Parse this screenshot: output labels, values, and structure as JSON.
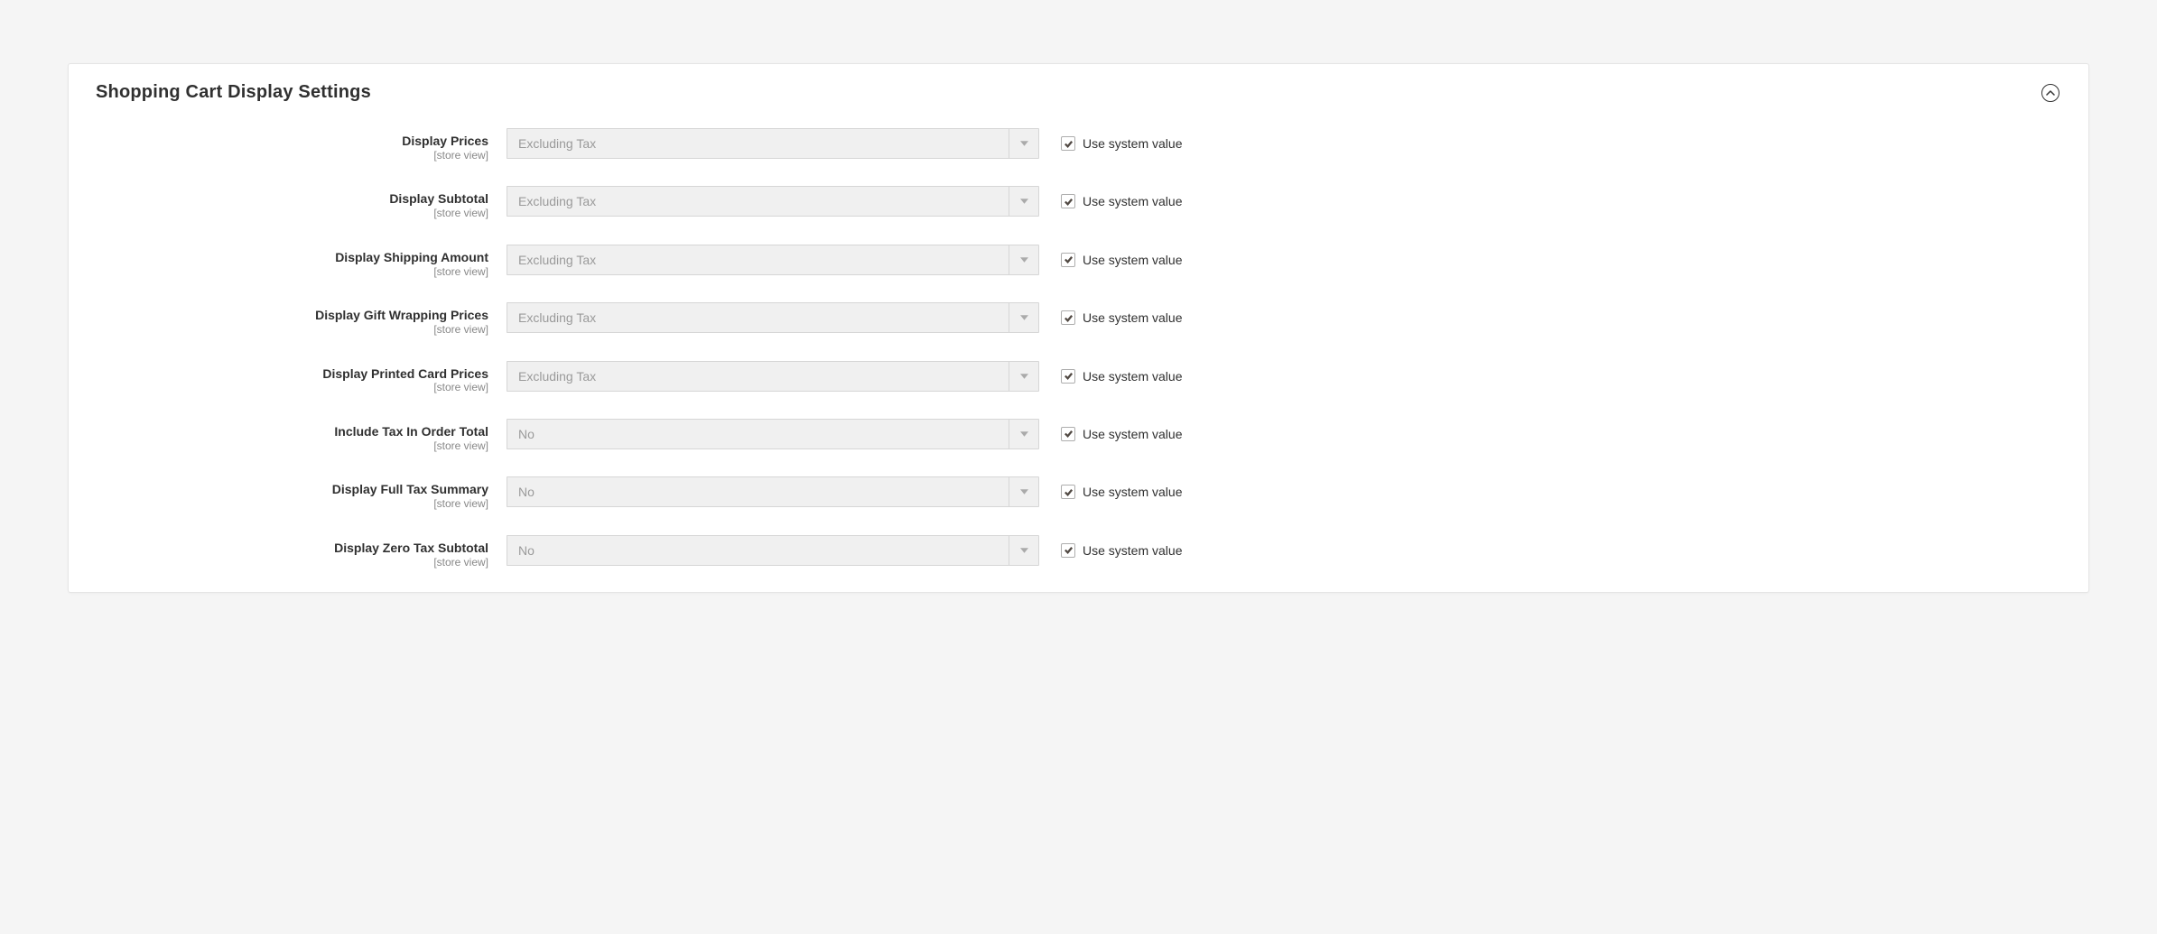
{
  "panel": {
    "title": "Shopping Cart Display Settings",
    "useSystemValueLabel": "Use system value",
    "scopeLabel": "[store view]",
    "fields": [
      {
        "label": "Display Prices",
        "value": "Excluding Tax",
        "useSystem": true
      },
      {
        "label": "Display Subtotal",
        "value": "Excluding Tax",
        "useSystem": true
      },
      {
        "label": "Display Shipping Amount",
        "value": "Excluding Tax",
        "useSystem": true
      },
      {
        "label": "Display Gift Wrapping Prices",
        "value": "Excluding Tax",
        "useSystem": true
      },
      {
        "label": "Display Printed Card Prices",
        "value": "Excluding Tax",
        "useSystem": true
      },
      {
        "label": "Include Tax In Order Total",
        "value": "No",
        "useSystem": true
      },
      {
        "label": "Display Full Tax Summary",
        "value": "No",
        "useSystem": true
      },
      {
        "label": "Display Zero Tax Subtotal",
        "value": "No",
        "useSystem": true
      }
    ]
  }
}
